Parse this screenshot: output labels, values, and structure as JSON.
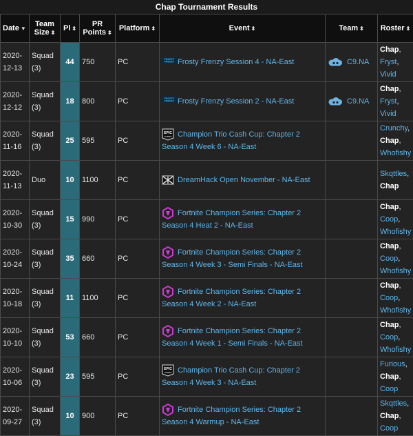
{
  "title": "Chap Tournament Results",
  "headers": {
    "date": "Date",
    "team_size": "Team Size",
    "pl": "Pl",
    "pr_points": "PR Points",
    "platform": "Platform",
    "event": "Event",
    "team": "Team",
    "roster": "Roster"
  },
  "colors": {
    "pl_bg": "#2b6a79",
    "link": "#5fb6ea",
    "fncs_icon": "#c93bd1",
    "frosty_icon": "#3fb3e6"
  },
  "rows": [
    {
      "date": "2020-12-13",
      "size": "Squad (3)",
      "pl": "44",
      "pr": "750",
      "platform": "PC",
      "event_icon": "frosty-frenzy-logo-icon",
      "event": "Frosty Frenzy Session 4 - NA-East",
      "team": "C9.NA",
      "roster": [
        "Chap",
        "Fryst",
        "Vivid"
      ]
    },
    {
      "date": "2020-12-12",
      "size": "Squad (3)",
      "pl": "18",
      "pr": "800",
      "platform": "PC",
      "event_icon": "frosty-frenzy-logo-icon",
      "event": "Frosty Frenzy Session 2 - NA-East",
      "team": "C9.NA",
      "roster": [
        "Chap",
        "Fryst",
        "Vivid"
      ]
    },
    {
      "date": "2020-11-16",
      "size": "Squad (3)",
      "pl": "25",
      "pr": "595",
      "platform": "PC",
      "event_icon": "epic-games-logo-icon",
      "event": "Champion Trio Cash Cup: Chapter 2 Season 4 Week 6 - NA-East",
      "team": "",
      "roster": [
        "Crunchy",
        "Chap",
        "Whofishy"
      ]
    },
    {
      "date": "2020-11-13",
      "size": "Duo",
      "pl": "10",
      "pr": "1100",
      "platform": "PC",
      "event_icon": "dreamhack-logo-icon",
      "event": "DreamHack Open November - NA-East",
      "team": "",
      "roster": [
        "Skqttles",
        "Chap"
      ]
    },
    {
      "date": "2020-10-30",
      "size": "Squad (3)",
      "pl": "15",
      "pr": "990",
      "platform": "PC",
      "event_icon": "fncs-logo-icon",
      "event": "Fortnite Champion Series: Chapter 2 Season 4 Heat 2 - NA-East",
      "team": "",
      "roster": [
        "Chap",
        "Coop",
        "Whofishy"
      ]
    },
    {
      "date": "2020-10-24",
      "size": "Squad (3)",
      "pl": "35",
      "pr": "660",
      "platform": "PC",
      "event_icon": "fncs-logo-icon",
      "event": "Fortnite Champion Series: Chapter 2 Season 4 Week 3 - Semi Finals - NA-East",
      "team": "",
      "roster": [
        "Chap",
        "Coop",
        "Whofishy"
      ]
    },
    {
      "date": "2020-10-18",
      "size": "Squad (3)",
      "pl": "11",
      "pr": "1100",
      "platform": "PC",
      "event_icon": "fncs-logo-icon",
      "event": "Fortnite Champion Series: Chapter 2 Season 4 Week 2 - NA-East",
      "team": "",
      "roster": [
        "Chap",
        "Coop",
        "Whofishy"
      ]
    },
    {
      "date": "2020-10-10",
      "size": "Squad (3)",
      "pl": "53",
      "pr": "660",
      "platform": "PC",
      "event_icon": "fncs-logo-icon",
      "event": "Fortnite Champion Series: Chapter 2 Season 4 Week 1 - Semi Finals - NA-East",
      "team": "",
      "roster": [
        "Chap",
        "Coop",
        "Whofishy"
      ]
    },
    {
      "date": "2020-10-06",
      "size": "Squad (3)",
      "pl": "23",
      "pr": "595",
      "platform": "PC",
      "event_icon": "epic-games-logo-icon",
      "event": "Champion Trio Cash Cup: Chapter 2 Season 4 Week 3 - NA-East",
      "team": "",
      "roster": [
        "Furious",
        "Chap",
        "Coop"
      ]
    },
    {
      "date": "2020-09-27",
      "size": "Squad (3)",
      "pl": "10",
      "pr": "900",
      "platform": "PC",
      "event_icon": "fncs-logo-icon",
      "event": "Fortnite Champion Series: Chapter 2 Season 4 Warmup - NA-East",
      "team": "",
      "roster": [
        "Skqttles",
        "Chap",
        "Coop"
      ]
    }
  ]
}
